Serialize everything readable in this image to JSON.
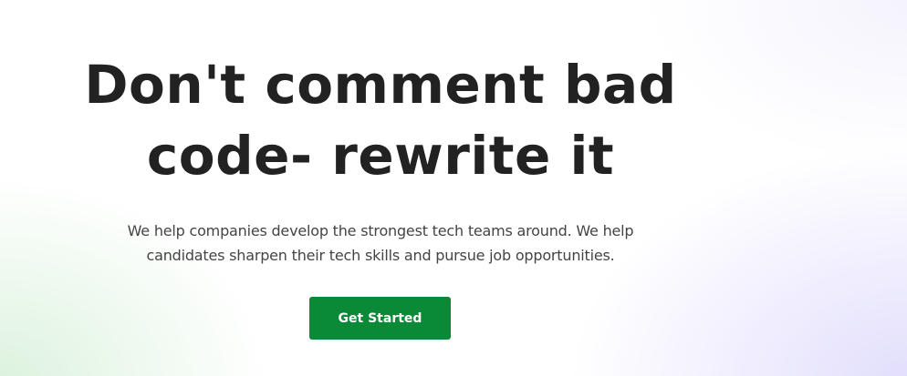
{
  "hero": {
    "title_line1": "Don't comment bad",
    "title_line2": "code- rewrite it",
    "subtitle": "We help companies develop the strongest tech teams around. We help candidates sharpen their tech skills and pursue job opportunities.",
    "cta_label": "Get Started"
  },
  "colors": {
    "cta_background": "#0a8a36",
    "title_text": "#222222",
    "subtitle_text": "#444444"
  }
}
